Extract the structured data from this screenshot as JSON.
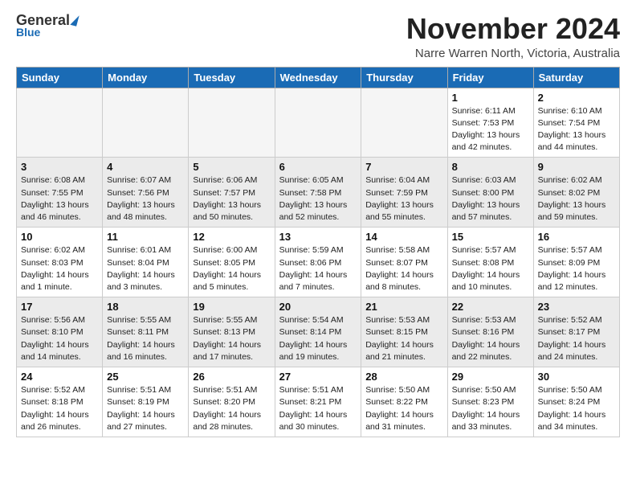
{
  "header": {
    "logo_general": "General",
    "logo_blue": "Blue",
    "month_title": "November 2024",
    "location": "Narre Warren North, Victoria, Australia"
  },
  "days_of_week": [
    "Sunday",
    "Monday",
    "Tuesday",
    "Wednesday",
    "Thursday",
    "Friday",
    "Saturday"
  ],
  "weeks": [
    [
      {
        "day": "",
        "info": ""
      },
      {
        "day": "",
        "info": ""
      },
      {
        "day": "",
        "info": ""
      },
      {
        "day": "",
        "info": ""
      },
      {
        "day": "",
        "info": ""
      },
      {
        "day": "1",
        "info": "Sunrise: 6:11 AM\nSunset: 7:53 PM\nDaylight: 13 hours\nand 42 minutes."
      },
      {
        "day": "2",
        "info": "Sunrise: 6:10 AM\nSunset: 7:54 PM\nDaylight: 13 hours\nand 44 minutes."
      }
    ],
    [
      {
        "day": "3",
        "info": "Sunrise: 6:08 AM\nSunset: 7:55 PM\nDaylight: 13 hours\nand 46 minutes."
      },
      {
        "day": "4",
        "info": "Sunrise: 6:07 AM\nSunset: 7:56 PM\nDaylight: 13 hours\nand 48 minutes."
      },
      {
        "day": "5",
        "info": "Sunrise: 6:06 AM\nSunset: 7:57 PM\nDaylight: 13 hours\nand 50 minutes."
      },
      {
        "day": "6",
        "info": "Sunrise: 6:05 AM\nSunset: 7:58 PM\nDaylight: 13 hours\nand 52 minutes."
      },
      {
        "day": "7",
        "info": "Sunrise: 6:04 AM\nSunset: 7:59 PM\nDaylight: 13 hours\nand 55 minutes."
      },
      {
        "day": "8",
        "info": "Sunrise: 6:03 AM\nSunset: 8:00 PM\nDaylight: 13 hours\nand 57 minutes."
      },
      {
        "day": "9",
        "info": "Sunrise: 6:02 AM\nSunset: 8:02 PM\nDaylight: 13 hours\nand 59 minutes."
      }
    ],
    [
      {
        "day": "10",
        "info": "Sunrise: 6:02 AM\nSunset: 8:03 PM\nDaylight: 14 hours\nand 1 minute."
      },
      {
        "day": "11",
        "info": "Sunrise: 6:01 AM\nSunset: 8:04 PM\nDaylight: 14 hours\nand 3 minutes."
      },
      {
        "day": "12",
        "info": "Sunrise: 6:00 AM\nSunset: 8:05 PM\nDaylight: 14 hours\nand 5 minutes."
      },
      {
        "day": "13",
        "info": "Sunrise: 5:59 AM\nSunset: 8:06 PM\nDaylight: 14 hours\nand 7 minutes."
      },
      {
        "day": "14",
        "info": "Sunrise: 5:58 AM\nSunset: 8:07 PM\nDaylight: 14 hours\nand 8 minutes."
      },
      {
        "day": "15",
        "info": "Sunrise: 5:57 AM\nSunset: 8:08 PM\nDaylight: 14 hours\nand 10 minutes."
      },
      {
        "day": "16",
        "info": "Sunrise: 5:57 AM\nSunset: 8:09 PM\nDaylight: 14 hours\nand 12 minutes."
      }
    ],
    [
      {
        "day": "17",
        "info": "Sunrise: 5:56 AM\nSunset: 8:10 PM\nDaylight: 14 hours\nand 14 minutes."
      },
      {
        "day": "18",
        "info": "Sunrise: 5:55 AM\nSunset: 8:11 PM\nDaylight: 14 hours\nand 16 minutes."
      },
      {
        "day": "19",
        "info": "Sunrise: 5:55 AM\nSunset: 8:13 PM\nDaylight: 14 hours\nand 17 minutes."
      },
      {
        "day": "20",
        "info": "Sunrise: 5:54 AM\nSunset: 8:14 PM\nDaylight: 14 hours\nand 19 minutes."
      },
      {
        "day": "21",
        "info": "Sunrise: 5:53 AM\nSunset: 8:15 PM\nDaylight: 14 hours\nand 21 minutes."
      },
      {
        "day": "22",
        "info": "Sunrise: 5:53 AM\nSunset: 8:16 PM\nDaylight: 14 hours\nand 22 minutes."
      },
      {
        "day": "23",
        "info": "Sunrise: 5:52 AM\nSunset: 8:17 PM\nDaylight: 14 hours\nand 24 minutes."
      }
    ],
    [
      {
        "day": "24",
        "info": "Sunrise: 5:52 AM\nSunset: 8:18 PM\nDaylight: 14 hours\nand 26 minutes."
      },
      {
        "day": "25",
        "info": "Sunrise: 5:51 AM\nSunset: 8:19 PM\nDaylight: 14 hours\nand 27 minutes."
      },
      {
        "day": "26",
        "info": "Sunrise: 5:51 AM\nSunset: 8:20 PM\nDaylight: 14 hours\nand 28 minutes."
      },
      {
        "day": "27",
        "info": "Sunrise: 5:51 AM\nSunset: 8:21 PM\nDaylight: 14 hours\nand 30 minutes."
      },
      {
        "day": "28",
        "info": "Sunrise: 5:50 AM\nSunset: 8:22 PM\nDaylight: 14 hours\nand 31 minutes."
      },
      {
        "day": "29",
        "info": "Sunrise: 5:50 AM\nSunset: 8:23 PM\nDaylight: 14 hours\nand 33 minutes."
      },
      {
        "day": "30",
        "info": "Sunrise: 5:50 AM\nSunset: 8:24 PM\nDaylight: 14 hours\nand 34 minutes."
      }
    ]
  ]
}
